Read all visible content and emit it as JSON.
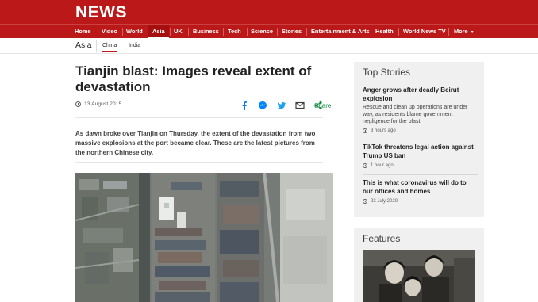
{
  "header": {
    "logo": "NEWS",
    "nav": [
      "Home",
      "Video",
      "World",
      "Asia",
      "UK",
      "Business",
      "Tech",
      "Science",
      "Stories",
      "Entertainment & Arts",
      "Health",
      "World News TV",
      "More"
    ],
    "active_nav": "Asia",
    "colors": {
      "brand": "#bb1919",
      "active_tab": "#a50f0f"
    }
  },
  "subnav": {
    "section": "Asia",
    "items": [
      "China",
      "India"
    ],
    "active": "China"
  },
  "article": {
    "headline": "Tianjin blast: Images reveal extent of devastation",
    "date": "13 August 2015",
    "share_label": "Share",
    "share_icons": [
      "facebook-icon",
      "messenger-icon",
      "twitter-icon",
      "email-icon",
      "share-icon"
    ],
    "intro": "As dawn broke over Tianjin on Thursday, the extent of the devastation from two massive explosions at the port became clear. These are the latest pictures from the northern Chinese city."
  },
  "sidebar": {
    "title": "Top Stories",
    "stories": [
      {
        "title": "Anger grows after deadly Beirut explosion",
        "summary": "Rescue and clean up operations are under way, as residents blame government negligence for the blast.",
        "time": "3 hours ago"
      },
      {
        "title": "TikTok threatens legal action against Trump US ban",
        "summary": "",
        "time": "1 hour ago"
      },
      {
        "title": "This is what coronavirus will do to our offices and homes",
        "summary": "",
        "time": "23 July 2020"
      }
    ]
  },
  "features": {
    "title": "Features"
  }
}
